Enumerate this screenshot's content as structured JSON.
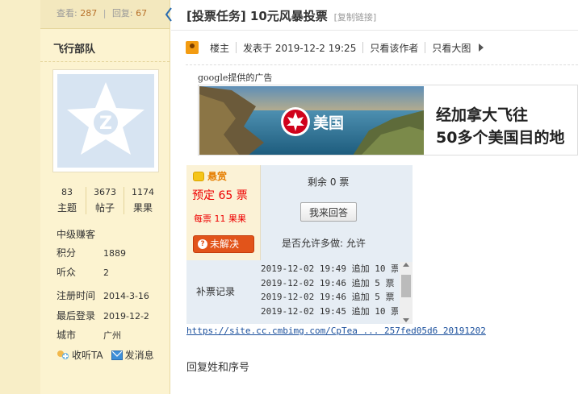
{
  "thread": {
    "views_label": "查看:",
    "views": "287",
    "separator": "|",
    "replies_label": "回复:",
    "replies": "67",
    "title": "[投票任务] 10元风暴投票",
    "copy_link": "[复制链接]"
  },
  "author": {
    "name": "飞行部队",
    "stats": [
      {
        "value": "83",
        "label": "主题"
      },
      {
        "value": "3673",
        "label": "帖子"
      },
      {
        "value": "1174",
        "label": "果果"
      }
    ],
    "rank": "中级赚客",
    "info": [
      {
        "key": "积分",
        "value": "1889"
      },
      {
        "key": "听众",
        "value": "2"
      },
      {
        "key": "注册时间",
        "value": "2014-3-16"
      },
      {
        "key": "最后登录",
        "value": "2019-12-2"
      },
      {
        "key": "城市",
        "value": "广州"
      }
    ],
    "follow_label": "收听TA",
    "message_label": "发消息"
  },
  "meta": {
    "floor": "楼主",
    "posted": "发表于 2019-12-2 19:25",
    "only_author": "只看该作者",
    "big_image": "只看大图"
  },
  "ad": {
    "label": "google提供的广告",
    "logo_text": "美国",
    "headline1": "经加拿大飞往",
    "headline2": "50多个美国目的地"
  },
  "bounty": {
    "tag": "悬赏",
    "amount": "预定 65 票",
    "per": "每票 11 果果",
    "unsolved": "未解决",
    "remaining": "剩余 0 票",
    "answer_button": "我来回答",
    "multi": "是否允许多做:  允许",
    "supp_label": "补票记录",
    "supp_records": [
      "2019-12-02 19:49 追加 10 票",
      "2019-12-02 19:46 追加 5 票",
      "2019-12-02 19:46 追加 5 票",
      "2019-12-02 19:45 追加 10 票"
    ]
  },
  "post": {
    "link": "https://site.cc.cmbimg.com/CpTea ... 257fed05d6 20191202",
    "text": "回复姓和序号"
  },
  "colors": {
    "sidebar_bg": "#fcf3d0",
    "bounty_bg": "#e6edf4",
    "accent_red": "#e00000",
    "link": "#1a4f9c"
  }
}
